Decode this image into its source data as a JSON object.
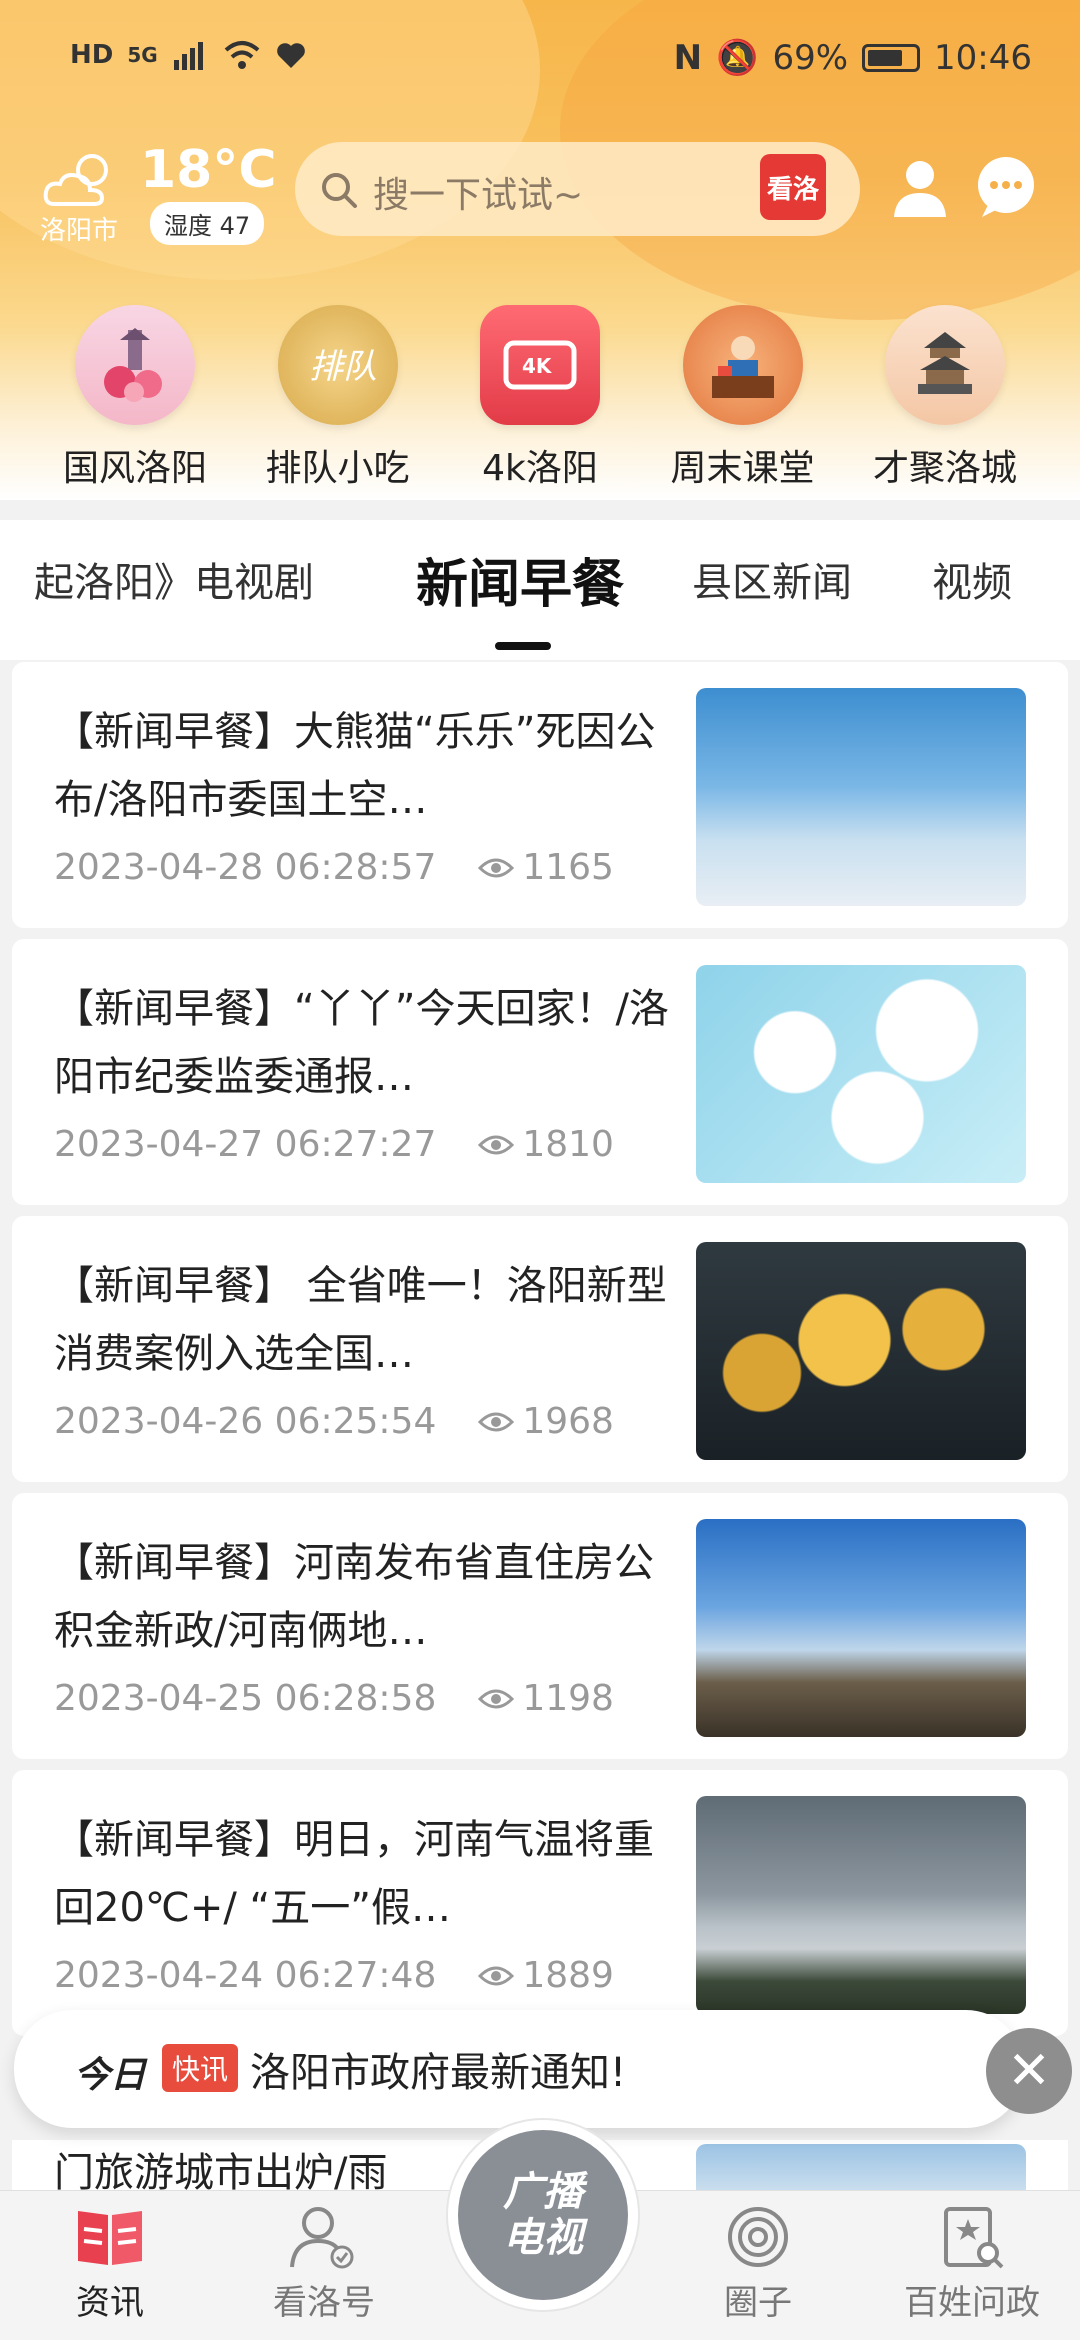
{
  "status_bar": {
    "left_icons": [
      "HD",
      "5G"
    ],
    "battery": "69%",
    "time": "10:46"
  },
  "header": {
    "weather": {
      "temp": "18°C",
      "city": "洛阳市",
      "humidity": "湿度 47"
    },
    "search": {
      "placeholder": "搜一下试试~",
      "badge": "看洛"
    }
  },
  "quick_links": [
    {
      "label": "国风洛阳",
      "icon": "pagoda-peony-icon"
    },
    {
      "label": "排队小吃",
      "icon": "snack-icon"
    },
    {
      "label": "4k洛阳",
      "icon": "4k-tv-icon"
    },
    {
      "label": "周末课堂",
      "icon": "teacher-icon"
    },
    {
      "label": "才聚洛城",
      "icon": "tower-icon"
    }
  ],
  "tabs": [
    "起洛阳》电视剧",
    "新闻早餐",
    "县区新闻",
    "视频"
  ],
  "active_tab": "新闻早餐",
  "articles": [
    {
      "title": "【新闻早餐】大熊猫“乐乐”死因公布/洛阳市委国土空…",
      "date": "2023-04-28 06:28:57",
      "views": "1165"
    },
    {
      "title": "【新闻早餐】“丫丫”今天回家！/洛阳市纪委监委通报…",
      "date": "2023-04-27 06:27:27",
      "views": "1810"
    },
    {
      "title": "【新闻早餐】 全省唯一！洛阳新型消费案例入选全国…",
      "date": "2023-04-26 06:25:54",
      "views": "1968"
    },
    {
      "title": "【新闻早餐】河南发布省直住房公积金新政/河南俩地…",
      "date": "2023-04-25 06:28:58",
      "views": "1198"
    },
    {
      "title": "【新闻早餐】明日，河南气温将重回20℃+/ “五一”假…",
      "date": "2023-04-24 06:27:48",
      "views": "1889"
    }
  ],
  "peek_text": "门旅游城市出炉/雨",
  "flash": {
    "today": "今日",
    "tag": "快讯",
    "message": "洛阳市政府最新通知!"
  },
  "bottom_nav": {
    "items": [
      "资讯",
      "看洛号",
      "圈子",
      "百姓问政"
    ],
    "center_line1": "广播",
    "center_line2": "电视"
  }
}
